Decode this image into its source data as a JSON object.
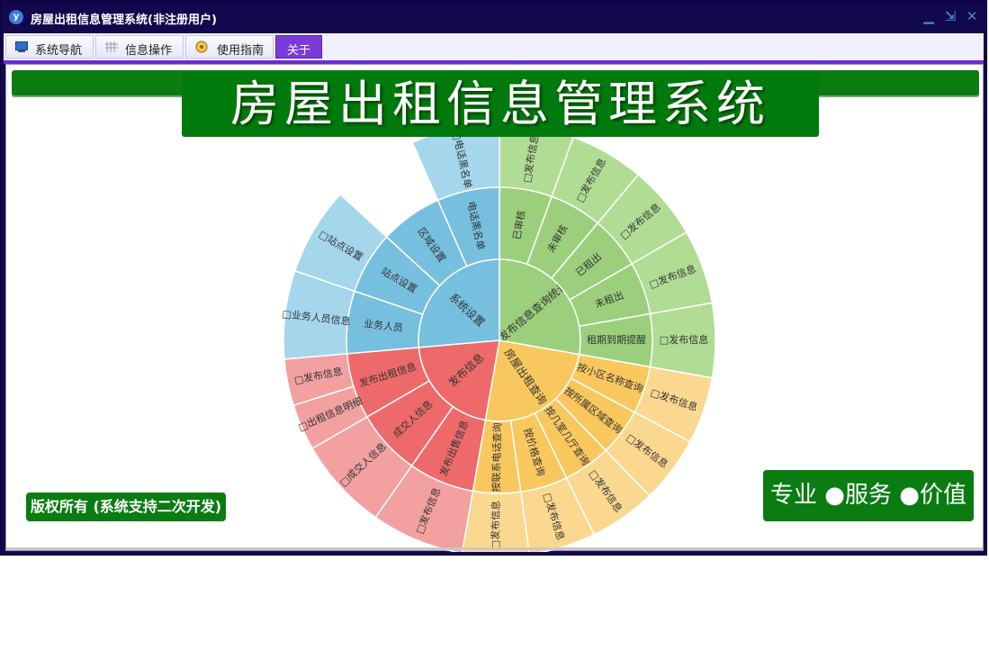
{
  "window": {
    "title": "房屋出租信息管理系统(非注册用户)"
  },
  "window_controls": {
    "minimize": "▁",
    "restore": "⇲",
    "close": "✕"
  },
  "tabs": [
    {
      "label": "系统导航",
      "icon": "monitor-icon"
    },
    {
      "label": "信息操作",
      "icon": "grid-icon"
    },
    {
      "label": "使用指南",
      "icon": "compass-icon"
    },
    {
      "label": "关于",
      "icon": ""
    }
  ],
  "banner": {
    "title": "房屋出租信息管理系统"
  },
  "footer": {
    "copyright": "版权所有 (系统支持二次开发)",
    "slogan": "专业 ●服务 ●价值"
  },
  "colors": {
    "titlebar": "#12084e",
    "accent": "#6a2cc9",
    "green": "#0a7c12"
  },
  "chart_data": {
    "type": "sunburst",
    "sectors": [
      {
        "name": "发布信息查询统计",
        "color": "#9ccf7c",
        "ring2": "#b0dc93",
        "children": [
          {
            "name": "已审核",
            "leaves": [
              "□发布信息"
            ]
          },
          {
            "name": "未审核",
            "leaves": [
              "□发布信息"
            ]
          },
          {
            "name": "已租出",
            "leaves": [
              "□发布信息"
            ]
          },
          {
            "name": "未租出",
            "leaves": [
              "□发布信息"
            ]
          },
          {
            "name": "租期到期提醒",
            "leaves": [
              "□发布信息"
            ]
          }
        ]
      },
      {
        "name": "房屋出租查询",
        "color": "#f8c85f",
        "ring2": "#fbd88f",
        "children": [
          {
            "name": "按小区名称查询",
            "leaves": [
              "□发布信息"
            ]
          },
          {
            "name": "按所属区域查询",
            "leaves": [
              "□发布信息"
            ]
          },
          {
            "name": "按几室几厅查询",
            "leaves": [
              "□发布信息"
            ]
          },
          {
            "name": "按价格查询",
            "leaves": [
              "□发布信息"
            ]
          },
          {
            "name": "按联系电话查询",
            "leaves": [
              "□发布信息"
            ]
          }
        ]
      },
      {
        "name": "发布信息",
        "color": "#ee6a6a",
        "ring2": "#f2a0a0",
        "children": [
          {
            "name": "发布出售信息",
            "leaves": [
              "□发布信息"
            ]
          },
          {
            "name": "成交人信息",
            "leaves": [
              "□成交人信息"
            ]
          },
          {
            "name": "发布出租信息",
            "leaves": [
              "□出租信息明细",
              "□发布信息"
            ]
          }
        ]
      },
      {
        "name": "系统设置",
        "color": "#76bfdf",
        "ring2": "#a4d6ec",
        "children": [
          {
            "name": "业务人员",
            "leaves": [
              "□业务人员信息"
            ]
          },
          {
            "name": "站点设置",
            "leaves": [
              "□站点设置"
            ]
          },
          {
            "name": "区域设置",
            "leaves": []
          },
          {
            "name": "电话黑名单",
            "leaves": [
              "□电话黑名单"
            ]
          }
        ]
      }
    ]
  }
}
